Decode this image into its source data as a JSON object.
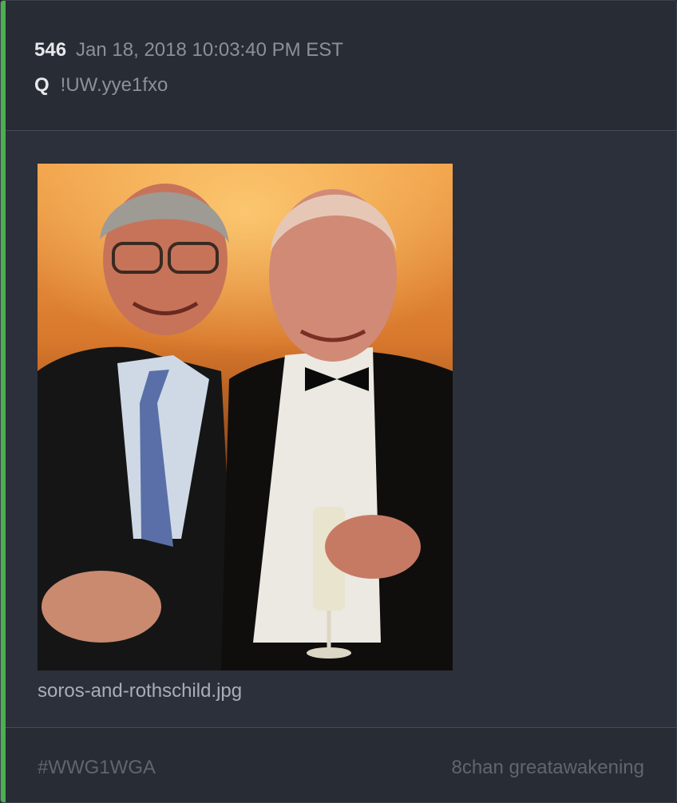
{
  "post": {
    "number": "546",
    "timestamp": "Jan 18, 2018 10:03:40 PM EST",
    "author": "Q",
    "tripcode": "!UW.yye1fxo"
  },
  "attachment": {
    "filename": "soros-and-rothschild.jpg"
  },
  "footer": {
    "hashtag": "#WWG1WGA",
    "source": "8chan greatawakening"
  },
  "colors": {
    "accent": "#4caf50",
    "card_bg": "#2b303a",
    "header_bg": "#282c35"
  }
}
